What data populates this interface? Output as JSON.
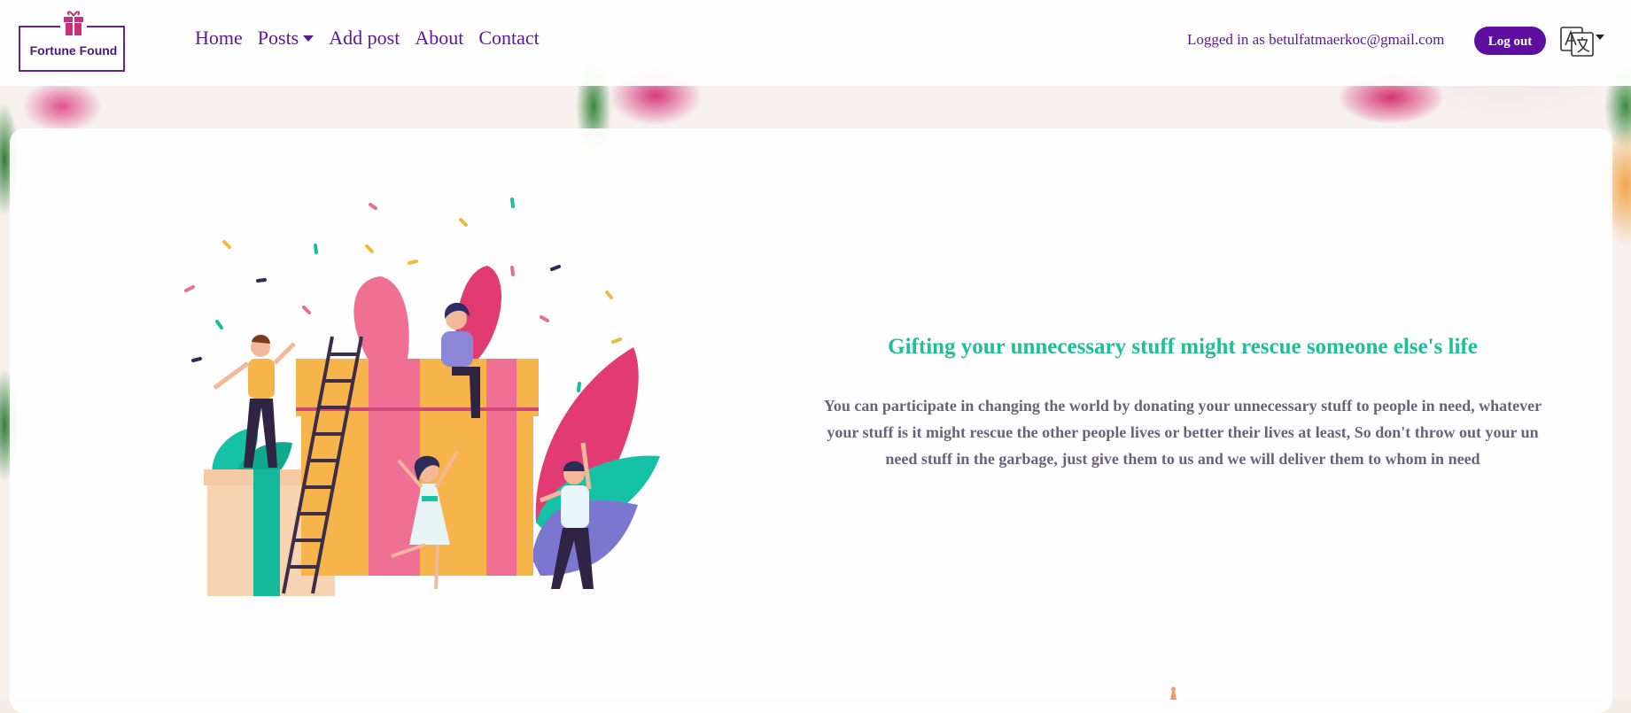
{
  "brand": {
    "name": "Fortune Found"
  },
  "nav": {
    "home": "Home",
    "posts": "Posts",
    "add_post": "Add post",
    "about": "About",
    "contact": "Contact"
  },
  "user": {
    "logged_in_text": "Logged in as betulfatmaerkoc@gmail.com",
    "logout_label": "Log out"
  },
  "language_icon": "translate-icon",
  "hero": {
    "headline": "Gifting your unnecessary stuff might rescue someone else's life",
    "description": "You can participate in changing the world by donating your unnecessary stuff to people in need, whatever your stuff is it might rescue the other people lives or better their lives at least, So don't throw out your un need stuff in the garbage, just give them to us and we will deliver them to whom in need"
  },
  "colors": {
    "brand_purple": "#5e0fa0",
    "accent_green": "#1dbf95",
    "gift_pink": "#c9307a"
  }
}
